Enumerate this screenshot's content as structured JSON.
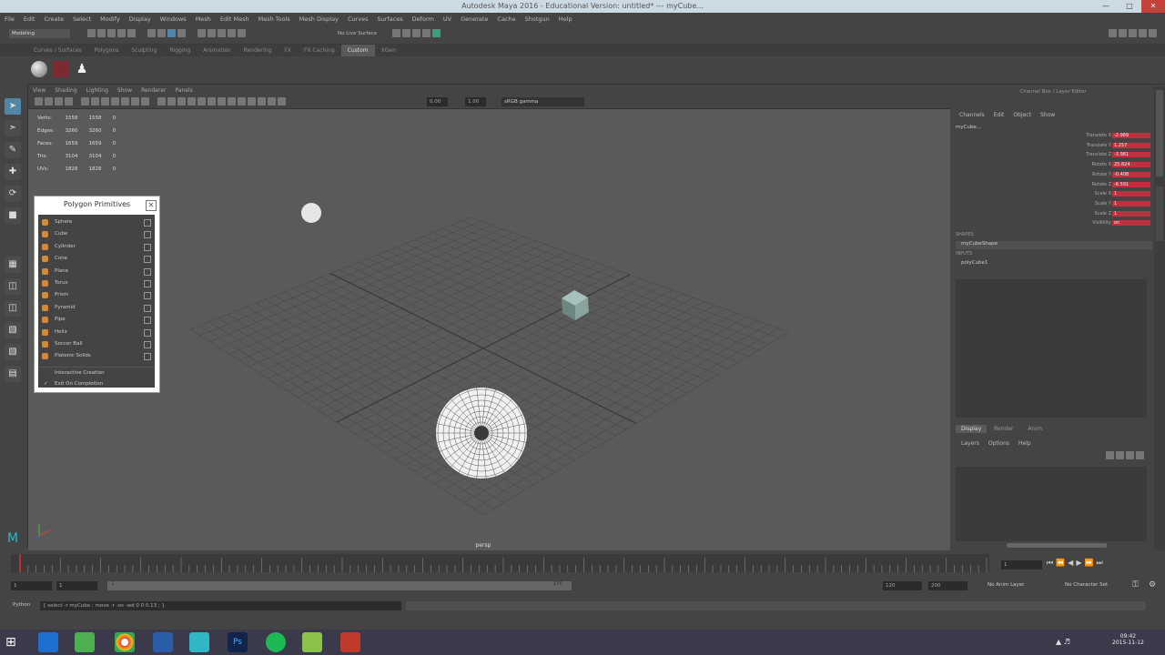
{
  "window": {
    "title": "Autodesk Maya 2016 - Educational Version: untitled*  ---  myCube..."
  },
  "menubar": [
    "File",
    "Edit",
    "Create",
    "Select",
    "Modify",
    "Display",
    "Windows",
    "Mesh",
    "Edit Mesh",
    "Mesh Tools",
    "Mesh Display",
    "Curves",
    "Surfaces",
    "Deform",
    "UV",
    "Generate",
    "Cache",
    "Shotgun",
    "Help"
  ],
  "statusline": {
    "mode": "Modeling",
    "live_surface": "No Live Surface"
  },
  "shelf_tabs": [
    "Curves / Surfaces",
    "Polygons",
    "Sculpting",
    "Rigging",
    "Animation",
    "Rendering",
    "FX",
    "FX Caching",
    "Custom",
    "XGen"
  ],
  "shelf_active": "Custom",
  "viewport": {
    "menu": [
      "View",
      "Shading",
      "Lighting",
      "Show",
      "Renderer",
      "Panels"
    ],
    "exposure": "0.00",
    "gamma": "1.00",
    "color_space": "sRGB gamma",
    "camera": "persp",
    "hud": [
      {
        "label": "Verts:",
        "a": "1558",
        "b": "1558",
        "c": "0"
      },
      {
        "label": "Edges:",
        "a": "3260",
        "b": "3260",
        "c": "0"
      },
      {
        "label": "Faces:",
        "a": "1659",
        "b": "1659",
        "c": "0"
      },
      {
        "label": "Tris:",
        "a": "3104",
        "b": "3104",
        "c": "0"
      },
      {
        "label": "UVs:",
        "a": "1828",
        "b": "1828",
        "c": "0"
      }
    ]
  },
  "polygon_primitives": {
    "title": "Polygon Primitives",
    "items": [
      "Sphere",
      "Cube",
      "Cylinder",
      "Cone",
      "Plane",
      "Torus",
      "Prism",
      "Pyramid",
      "Pipe",
      "Helix",
      "Soccer Ball",
      "Platonic Solids"
    ],
    "options": [
      {
        "label": "Interactive Creation",
        "checked": false
      },
      {
        "label": "Exit On Completion",
        "checked": true
      }
    ]
  },
  "channel_box": {
    "title": "Channel Box / Layer Editor",
    "menu": [
      "Channels",
      "Edit",
      "Object",
      "Show"
    ],
    "object": "myCube...",
    "channels": [
      {
        "name": "Translate X",
        "value": "-2.989"
      },
      {
        "name": "Translate Y",
        "value": "1.257"
      },
      {
        "name": "Translate Z",
        "value": "-3.981"
      },
      {
        "name": "Rotate X",
        "value": "25.824"
      },
      {
        "name": "Rotate Y",
        "value": "-0.408"
      },
      {
        "name": "Rotate Z",
        "value": "-6.591"
      },
      {
        "name": "Scale X",
        "value": "1"
      },
      {
        "name": "Scale Y",
        "value": "1"
      },
      {
        "name": "Scale Z",
        "value": "1"
      },
      {
        "name": "Visibility",
        "value": "on"
      }
    ],
    "shapes_label": "SHAPES",
    "shape": "myCubeShape",
    "inputs_label": "INPUTS",
    "input": "polyCube1"
  },
  "layer_editor": {
    "tabs": [
      "Display",
      "Render",
      "Anim"
    ],
    "menu": [
      "Layers",
      "Options",
      "Help"
    ]
  },
  "time": {
    "current_frame": "1",
    "range_start": "1",
    "range_start_inner": "1",
    "range_end_inner": "120",
    "range_end": "120",
    "anim_end": "200",
    "anim_layer": "No Anim Layer",
    "char_set": "No Character Set"
  },
  "cmdline": {
    "language": "Python",
    "text": "{ select -r myCube ; move -r -os -wd 0 0 0.13 ; }"
  },
  "taskbar": {
    "time": "09:42",
    "date": "2015-11-12"
  },
  "colors": {
    "accent": "#5285a6",
    "channel_red": "#c0303e"
  }
}
